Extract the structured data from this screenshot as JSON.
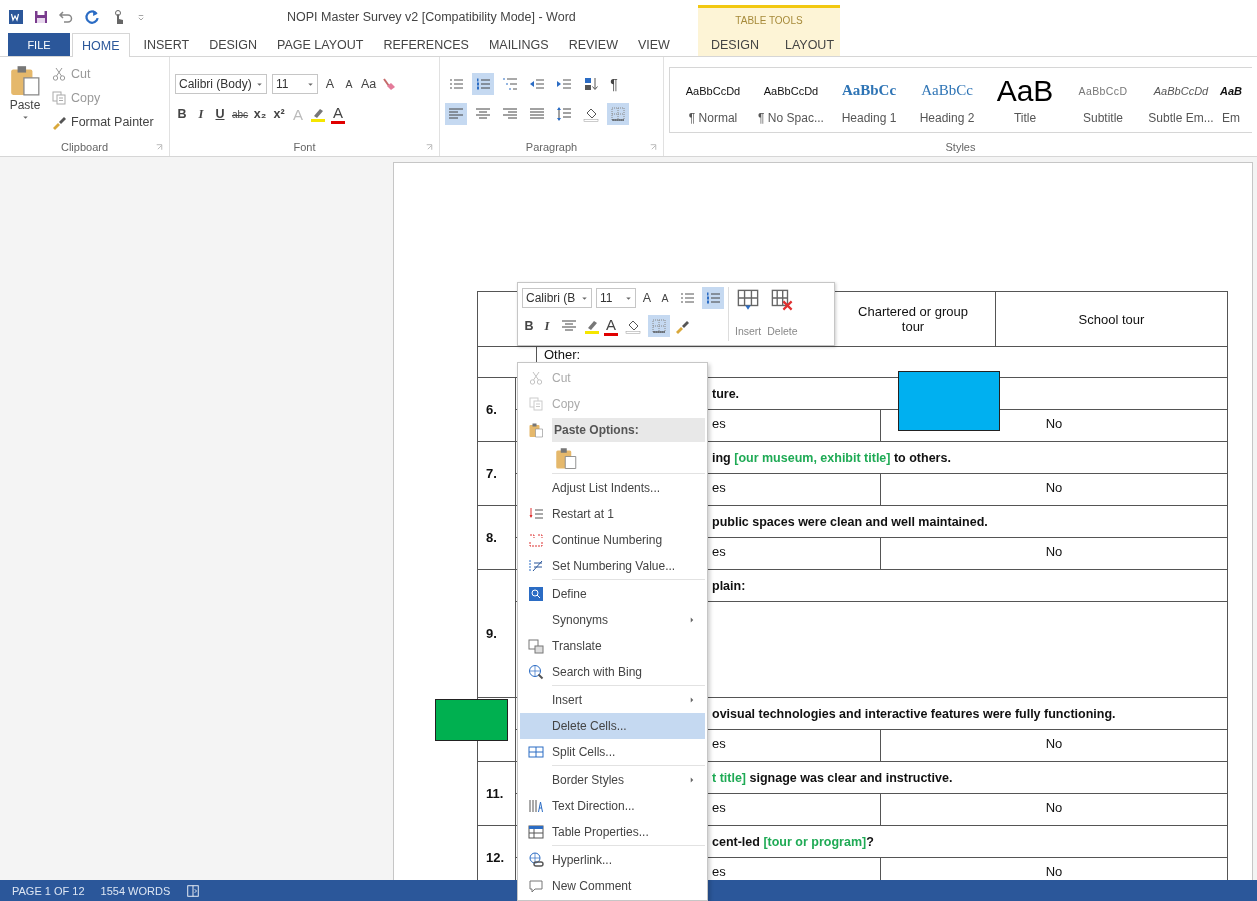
{
  "title_bar": {
    "title": "NOPI Master Survey v2 [Compatibility Mode] - Word",
    "contextual_group": "TABLE TOOLS"
  },
  "tabs": [
    {
      "label": "FILE",
      "kind": "file",
      "selected": false
    },
    {
      "label": "HOME",
      "kind": "normal",
      "selected": true
    },
    {
      "label": "INSERT",
      "kind": "normal",
      "selected": false
    },
    {
      "label": "DESIGN",
      "kind": "normal",
      "selected": false
    },
    {
      "label": "PAGE LAYOUT",
      "kind": "normal",
      "selected": false
    },
    {
      "label": "REFERENCES",
      "kind": "normal",
      "selected": false
    },
    {
      "label": "MAILINGS",
      "kind": "normal",
      "selected": false
    },
    {
      "label": "REVIEW",
      "kind": "normal",
      "selected": false
    },
    {
      "label": "VIEW",
      "kind": "normal",
      "selected": false
    },
    {
      "label": "DESIGN",
      "kind": "contextual",
      "selected": false
    },
    {
      "label": "LAYOUT",
      "kind": "contextual",
      "selected": false
    }
  ],
  "clipboard": {
    "paste": "Paste",
    "cut": "Cut",
    "copy": "Copy",
    "format_painter": "Format Painter",
    "label": "Clipboard"
  },
  "font": {
    "font_name": "Calibri (Body)",
    "font_size": "11",
    "grow": "A",
    "shrink": "A",
    "change_case": "Aa",
    "bold": "B",
    "italic": "I",
    "underline": "U",
    "strikethrough": "abc",
    "subscript": "x₂",
    "superscript": "x²",
    "text_effects": "A",
    "font_color": "A",
    "label": "Font"
  },
  "paragraph": {
    "label": "Paragraph",
    "show_marks": "¶",
    "row1": [
      {
        "selected": false
      },
      {
        "selected": true
      },
      {
        "selected": false
      },
      {
        "selected": false
      },
      {
        "selected": false
      },
      {
        "selected": false
      }
    ],
    "row2": [
      {
        "selected": true
      },
      {
        "selected": false
      },
      {
        "selected": false
      },
      {
        "selected": false
      },
      {
        "selected": false
      },
      {
        "selected": false
      },
      {
        "selected": true
      }
    ]
  },
  "styles": {
    "label": "Styles",
    "items": [
      {
        "preview": "AaBbCcDd",
        "name": "¶ Normal",
        "kind": "normal"
      },
      {
        "preview": "AaBbCcDd",
        "name": "¶ No Spac...",
        "kind": "normal"
      },
      {
        "preview": "AaBbCc",
        "name": "Heading 1",
        "kind": "heading1"
      },
      {
        "preview": "AaBbCc",
        "name": "Heading 2",
        "kind": "heading2"
      },
      {
        "preview": "AaB",
        "name": "Title",
        "kind": "title"
      },
      {
        "preview": "AaBbCcD",
        "name": "Subtitle",
        "kind": "subtitle"
      },
      {
        "preview": "AaBbCcDd",
        "name": "Subtle Em...",
        "kind": "subtle"
      },
      {
        "preview": "AaB",
        "name": "Em",
        "kind": "emphasis"
      }
    ]
  },
  "mini_toolbar": {
    "font_name": "Calibri (B",
    "font_size": "11",
    "grow": "A",
    "shrink": "A",
    "bold": "B",
    "italic": "I",
    "font_color": "A",
    "insert": "Insert",
    "delete": "Delete",
    "numbering_selected": true,
    "borders_selected": true
  },
  "document": {
    "header_cells": [
      "Chartered or group tour",
      "School tour"
    ],
    "other": "Other:",
    "questions": [
      {
        "number": "6.",
        "kind": "yes-no",
        "segments": [
          {
            "text": "ture.",
            "placeholder": false
          }
        ],
        "answers": [
          "es",
          "No"
        ]
      },
      {
        "number": "7.",
        "kind": "yes-no",
        "segments": [
          {
            "text": "ing ",
            "placeholder": false
          },
          {
            "text": "[our museum, exhibit title]",
            "placeholder": true
          },
          {
            "text": " to others.",
            "placeholder": false
          }
        ],
        "answers": [
          "es",
          "No"
        ]
      },
      {
        "number": "8.",
        "kind": "yes-no",
        "segments": [
          {
            "text": "public spaces were clean and well maintained.",
            "placeholder": false
          }
        ],
        "answers": [
          "es",
          "No"
        ]
      },
      {
        "number": "9.",
        "kind": "open",
        "segments": [
          {
            "text": "plain:",
            "placeholder": false
          }
        ]
      },
      {
        "kind": "yes-no",
        "segments": [
          {
            "text": "ovisual technologies and interactive features were fully functioning.",
            "placeholder": false
          }
        ],
        "answers": [
          "es",
          "No"
        ]
      },
      {
        "number": "11.",
        "kind": "yes-no",
        "segments": [
          {
            "text": "t title]",
            "placeholder": true
          },
          {
            "text": " signage was clear and instructive.",
            "placeholder": false
          }
        ],
        "answers": [
          "es",
          "No"
        ]
      },
      {
        "number": "12.",
        "kind": "yes-no",
        "segments": [
          {
            "text": "cent-led ",
            "placeholder": false
          },
          {
            "text": "[tour or program]",
            "placeholder": true
          },
          {
            "text": "?",
            "placeholder": false
          }
        ],
        "answers": [
          "es",
          "No"
        ]
      }
    ]
  },
  "annotation_boxes": [
    {
      "color": "#00b0f0"
    },
    {
      "color": "#00b050"
    }
  ],
  "context_menu": [
    {
      "label": "Cut",
      "kind": "item",
      "disabled": true,
      "selected": false
    },
    {
      "label": "Copy",
      "kind": "item",
      "disabled": true,
      "selected": false
    },
    {
      "label": "Paste Options:",
      "kind": "header"
    },
    {
      "kind": "paste"
    },
    {
      "kind": "separator"
    },
    {
      "label": "Adjust List Indents...",
      "kind": "item",
      "disabled": false,
      "selected": false
    },
    {
      "label": "Restart at 1",
      "kind": "item",
      "disabled": false,
      "selected": false
    },
    {
      "label": "Continue Numbering",
      "kind": "item",
      "disabled": false,
      "selected": false
    },
    {
      "label": "Set Numbering Value...",
      "kind": "item",
      "disabled": false,
      "selected": false
    },
    {
      "kind": "separator"
    },
    {
      "label": "Define",
      "kind": "item",
      "disabled": false,
      "selected": false
    },
    {
      "label": "Synonyms",
      "kind": "submenu",
      "disabled": false,
      "selected": false
    },
    {
      "label": "Translate",
      "kind": "item",
      "disabled": false,
      "selected": false
    },
    {
      "label": "Search with Bing",
      "kind": "item",
      "disabled": false,
      "selected": false
    },
    {
      "kind": "separator"
    },
    {
      "label": "Insert",
      "kind": "submenu",
      "disabled": false,
      "selected": false
    },
    {
      "label": "Delete Cells...",
      "kind": "item",
      "disabled": false,
      "selected": true
    },
    {
      "label": "Split Cells...",
      "kind": "item",
      "disabled": false,
      "selected": false
    },
    {
      "kind": "separator"
    },
    {
      "label": "Border Styles",
      "kind": "submenu",
      "disabled": false,
      "selected": false
    },
    {
      "label": "Text Direction...",
      "kind": "item",
      "disabled": false,
      "selected": false
    },
    {
      "label": "Table Properties...",
      "kind": "item",
      "disabled": false,
      "selected": false
    },
    {
      "kind": "separator"
    },
    {
      "label": "Hyperlink...",
      "kind": "item",
      "disabled": false,
      "selected": false
    },
    {
      "label": "New Comment",
      "kind": "item",
      "disabled": false,
      "selected": false
    }
  ],
  "status_bar": {
    "page": "PAGE 1 OF 12",
    "words": "1554 WORDS"
  }
}
